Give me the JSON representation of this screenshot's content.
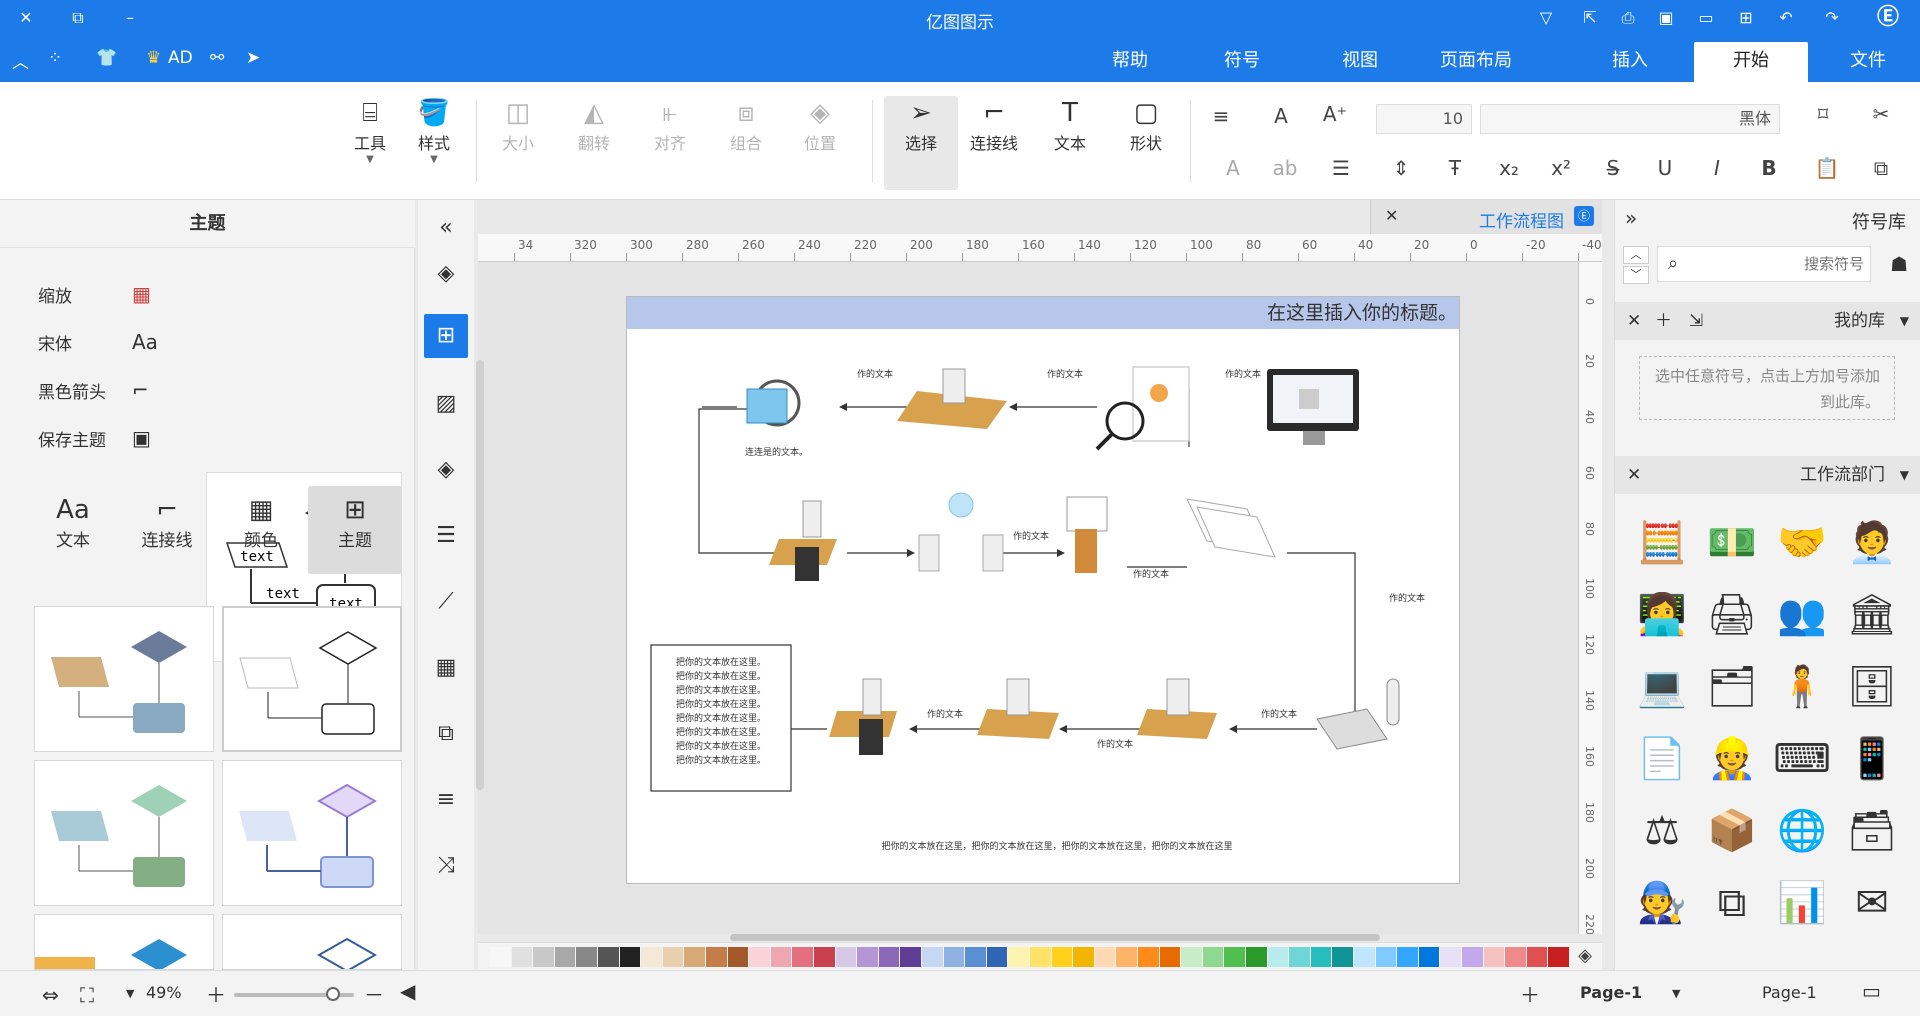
{
  "app": {
    "title": "亿图图示"
  },
  "menu": {
    "tabs": [
      "文件",
      "开始",
      "插入",
      "页面布局",
      "视图",
      "符号",
      "帮助"
    ],
    "active": "开始",
    "quick_label": "AD"
  },
  "ribbon": {
    "font_name": "黑体",
    "font_size": "10",
    "shape": "形状",
    "text": "文本",
    "connector": "连接线",
    "select": "选择",
    "position": "位置",
    "group": "组合",
    "align": "对齐",
    "flip": "翻转",
    "size": "大小",
    "style": "样式",
    "tools": "工具"
  },
  "left_panel": {
    "title": "主题",
    "options": [
      "缩放",
      "宋体",
      "黑色箭头",
      "保存主题"
    ],
    "buttons": [
      "主题",
      "颜色",
      "连接线",
      "文本"
    ],
    "preview_text": "text"
  },
  "doc": {
    "tab_title": "工作流程图",
    "page_title": "在这里插入你的标题。"
  },
  "ruler_h": [
    "-40",
    "-20",
    "0",
    "20",
    "40",
    "60",
    "80",
    "100",
    "120",
    "140",
    "160",
    "180",
    "200",
    "220",
    "240",
    "260",
    "280",
    "300",
    "320",
    "34"
  ],
  "ruler_v": [
    "0",
    "20",
    "40",
    "60",
    "80",
    "100",
    "120",
    "140",
    "160",
    "180",
    "200",
    "220"
  ],
  "diagram": {
    "label": "作的文本",
    "label_check": "连连是的文本。",
    "note_line": "把你的文本放在这里。",
    "footer": "把你的文本放在这里，把你的文本放在这里，把你的文本放在这里，把你的文本放在这里"
  },
  "right_panel": {
    "title": "符号库",
    "search_placeholder": "搜索符号",
    "my_lib": "我的库",
    "hint": "选中任意符号，点击上方加号添加到此库。",
    "dept": "工作流部门"
  },
  "status": {
    "page_selector": "Page-1",
    "page_tab": "Page-1",
    "zoom": "49%"
  },
  "palette": [
    "#f7f7f7",
    "#e0e0e0",
    "#c8c8c8",
    "#a8a8a8",
    "#888888",
    "#555555",
    "#222222",
    "#f4e8d8",
    "#e8cfae",
    "#d7a977",
    "#c47d48",
    "#a35a2a",
    "#f9d3d8",
    "#f0a6b0",
    "#e46f7e",
    "#c9404f",
    "#d8c8e8",
    "#b596d4",
    "#8c68b8",
    "#5f3d95",
    "#c6d8f1",
    "#8fb2e3",
    "#5b8fd3",
    "#2f65b5",
    "#fff3b0",
    "#ffe266",
    "#ffd11a",
    "#f2b600",
    "#ffd9b3",
    "#ffb366",
    "#ff8c1a",
    "#e66a00",
    "#c8ecc8",
    "#8fd88f",
    "#4fbf4f",
    "#2a9a2a",
    "#b8ecec",
    "#6fd6d6",
    "#27bdbd",
    "#0f9595",
    "#bfe6ff",
    "#7fcaff",
    "#33a6ff",
    "#0077dd",
    "#e8e0f5",
    "#c4a8ec",
    "#f5c2c2",
    "#ee8a8a",
    "#e05050",
    "#c82020"
  ]
}
